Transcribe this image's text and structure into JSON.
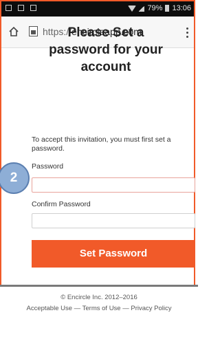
{
  "status_bar": {
    "signal_battery": "79%",
    "time": "13:06"
  },
  "browser": {
    "url_scheme": "https://",
    "url_host": "encircleapp.com"
  },
  "page": {
    "title_line1": "Please Set a",
    "title_line2": "password for your",
    "title_line3": "account",
    "intro": "To accept this invitation, you must first set a password.",
    "password_label": "Password",
    "password_value": "",
    "confirm_label": "Confirm Password",
    "confirm_value": "",
    "submit_label": "Set Password"
  },
  "annotation": {
    "step": "2"
  },
  "footer": {
    "copyright": "© Encircle Inc. 2012–2016",
    "links": "Acceptable Use — Terms of Use — Privacy Policy"
  },
  "colors": {
    "accent": "#f15a29",
    "badge": "#8eaed6"
  }
}
